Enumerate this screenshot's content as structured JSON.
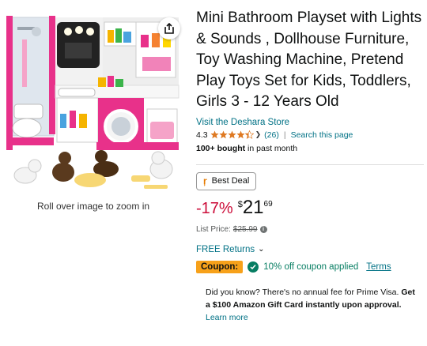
{
  "image": {
    "zoom_hint": "Roll over image to zoom in",
    "share_icon": "share-icon"
  },
  "product": {
    "title": "Mini Bathroom Playset with Lights & Sounds , Dollhouse Furniture, Toy Washing Machine, Pretend Play Toys Set for Kids, Toddlers, Girls 3 - 12 Years Old",
    "store_link": "Visit the Deshara Store",
    "rating_value": "4.3",
    "rating_stars": 4.3,
    "rating_count": "(26)",
    "separator": "|",
    "search_page": "Search this page",
    "bought_bold": "100+ bought",
    "bought_rest": " in past month"
  },
  "deal": {
    "badge_icon": "ŗ",
    "badge_label": "Best Deal"
  },
  "price": {
    "discount": "-17%",
    "currency": "$",
    "whole": "21",
    "fraction": "69",
    "list_label": "List Price:",
    "list_value": "$25.99",
    "info_icon": "i"
  },
  "returns": {
    "label": "FREE Returns"
  },
  "coupon": {
    "badge": "Coupon:",
    "text": "10% off coupon applied",
    "terms": "Terms"
  },
  "promo": {
    "part1": "Did you know? There's no annual fee for Prime Visa. ",
    "bold": "Get a $100 Amazon Gift Card instantly upon approval.",
    "link": "Learn more"
  },
  "colors": {
    "accent_link": "#007185",
    "price_red": "#cc0c39",
    "coupon_orange": "#f7a11a",
    "success_green": "#067d62",
    "star_orange": "#de7921",
    "toy_pink": "#e8318a"
  }
}
